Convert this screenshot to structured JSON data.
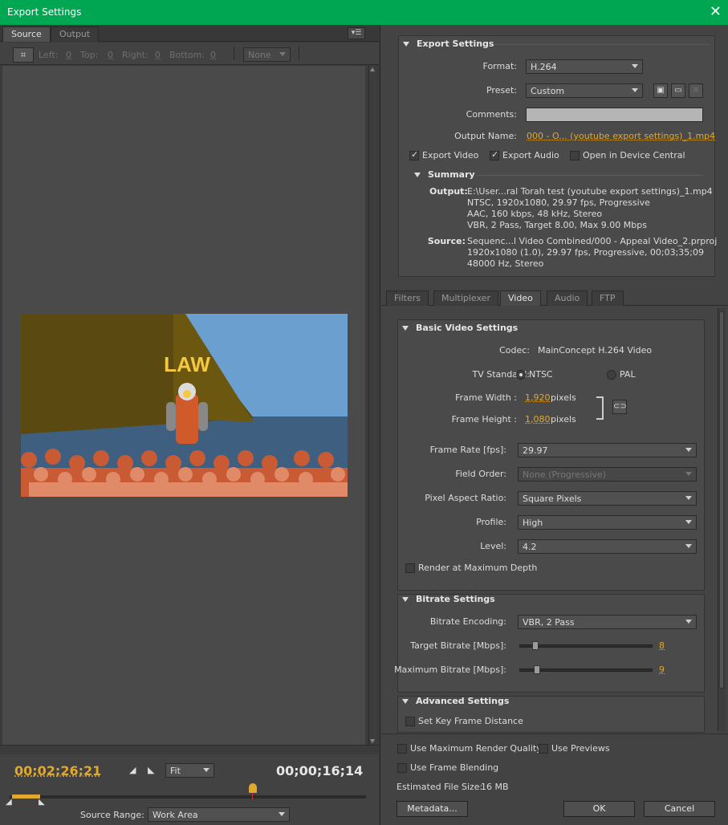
{
  "window": {
    "title": "Export Settings"
  },
  "left": {
    "tabs": [
      {
        "label": "Source"
      },
      {
        "label": "Output"
      }
    ],
    "crop": {
      "left_label": "Left:",
      "left_val": "0",
      "top_label": "Top:",
      "top_val": "0",
      "right_label": "Right:",
      "right_val": "0",
      "bottom_label": "Bottom:",
      "bottom_val": "0",
      "preset": "None"
    },
    "preview_text": "LAW",
    "timecode_current": "00;02;26;21",
    "timecode_duration": "00;00;16;14",
    "zoom": "Fit",
    "source_range_label": "Source Range:",
    "source_range_value": "Work Area"
  },
  "export": {
    "section_title": "Export Settings",
    "format_label": "Format:",
    "format_value": "H.264",
    "preset_label": "Preset:",
    "preset_value": "Custom",
    "comments_label": "Comments:",
    "output_name_label": "Output Name:",
    "output_name_value": "000 - O... (youtube export settings)_1.mp4",
    "export_video": "Export Video",
    "export_audio": "Export Audio",
    "device_central": "Open in Device Central",
    "summary_title": "Summary",
    "output_label": "Output:",
    "output_lines": [
      "E:\\User...ral Torah test (youtube export settings)_1.mp4",
      "NTSC, 1920x1080, 29.97 fps, Progressive",
      "AAC, 160 kbps, 48 kHz, Stereo",
      "VBR, 2 Pass, Target 8.00, Max 9.00 Mbps"
    ],
    "source_label": "Source:",
    "source_lines": [
      "Sequenc...l Video Combined/000 - Appeal Video_2.prproj",
      "1920x1080 (1.0), 29.97 fps, Progressive, 00;03;35;09",
      "48000 Hz, Stereo"
    ]
  },
  "tabs": [
    {
      "label": "Filters"
    },
    {
      "label": "Multiplexer"
    },
    {
      "label": "Video"
    },
    {
      "label": "Audio"
    },
    {
      "label": "FTP"
    }
  ],
  "video": {
    "basic_title": "Basic Video Settings",
    "codec_label": "Codec:",
    "codec_value": "MainConcept H.264 Video",
    "tv_label": "TV Standard:",
    "ntsc": "NTSC",
    "pal": "PAL",
    "fw_label": "Frame Width :",
    "fw_value": "1,920",
    "fh_label": "Frame Height :",
    "fh_value": "1,080",
    "pixels": "pixels",
    "fr_label": "Frame Rate [fps]:",
    "fr_value": "29.97",
    "fo_label": "Field Order:",
    "fo_value": "None (Progressive)",
    "par_label": "Pixel Aspect Ratio:",
    "par_value": "Square Pixels",
    "profile_label": "Profile:",
    "profile_value": "High",
    "level_label": "Level:",
    "level_value": "4.2",
    "render_max": "Render at Maximum Depth",
    "bitrate_title": "Bitrate Settings",
    "enc_label": "Bitrate Encoding:",
    "enc_value": "VBR, 2 Pass",
    "target_label": "Target Bitrate [Mbps]:",
    "target_value": "8",
    "max_label": "Maximum Bitrate [Mbps]:",
    "max_value": "9",
    "adv_title": "Advanced Settings",
    "keyframe": "Set Key Frame Distance"
  },
  "footer": {
    "max_quality": "Use Maximum Render Quality",
    "previews": "Use Previews",
    "blending": "Use Frame Blending",
    "filesize_label": "Estimated File Size:",
    "filesize_value": "16 MB",
    "metadata": "Metadata...",
    "ok": "OK",
    "cancel": "Cancel"
  }
}
